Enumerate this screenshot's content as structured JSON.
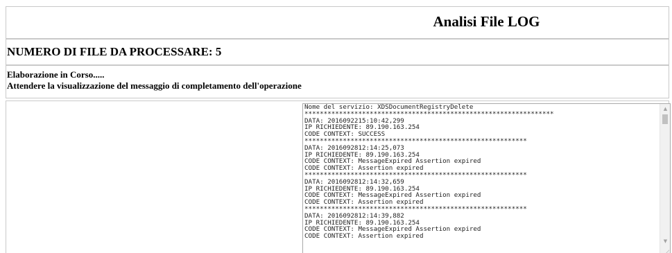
{
  "header": {
    "title": "Analisi File LOG"
  },
  "summary": {
    "file_count_text": "NUMERO DI FILE DA PROCESSARE: 5"
  },
  "status": {
    "line1": "Elaborazione in Corso.....",
    "line2": "Attendere la visualizzazione del messaggio di completamento dell'operazione"
  },
  "log": {
    "lines": [
      "Nome del servizio: XDSDocumentRegistryDelete",
      "*****************************************************************",
      "DATA: 2016092215:10:42,299",
      "IP RICHIEDENTE: 89.190.163.254",
      "CODE CONTEXT: SUCCESS",
      "**********************************************************",
      "DATA: 2016092812:14:25,073",
      "IP RICHIEDENTE: 89.190.163.254",
      "CODE CONTEXT: MessageExpired Assertion expired",
      "CODE CONTEXT: Assertion expired",
      "**********************************************************",
      "DATA: 2016092812:14:32,659",
      "IP RICHIEDENTE: 89.190.163.254",
      "CODE CONTEXT: MessageExpired Assertion expired",
      "CODE CONTEXT: Assertion expired",
      "**********************************************************",
      "DATA: 2016092812:14:39,882",
      "IP RICHIEDENTE: 89.190.163.254",
      "CODE CONTEXT: MessageExpired Assertion expired",
      "CODE CONTEXT: Assertion expired"
    ],
    "scroll_up_icon": "triangle-up-icon",
    "scroll_down_icon": "triangle-down-icon"
  }
}
